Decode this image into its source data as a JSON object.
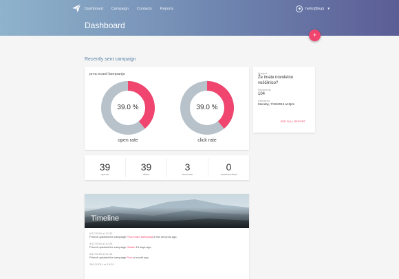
{
  "header": {
    "nav": [
      "Dashboard",
      "Campaign",
      "Contacts",
      "Reports"
    ],
    "user_name": "hello@kupi",
    "page_title": "Dashboard",
    "fab_label": "+"
  },
  "campaign": {
    "section_title": "Recently sent campaign",
    "name": "prva ecard kampanja",
    "open_rate": {
      "value": "39.0 %",
      "label": "open rate",
      "fraction": 0.39
    },
    "click_rate": {
      "value": "39.0 %",
      "label": "click rate",
      "fraction": 0.39
    },
    "colors": {
      "accent": "#f0456e",
      "track": "#b7c2ca"
    }
  },
  "info": {
    "subject_label": "Subject",
    "subject": "Že imate novoletno voščilnico?",
    "recipients_label": "Recipients",
    "recipients": "104",
    "date_label": "Delivered",
    "date": "Monday, 7/15/2015 at 8pm",
    "link_label": "SEE FULL REPORT"
  },
  "stats": [
    {
      "value": "39",
      "label": "opens"
    },
    {
      "value": "39",
      "label": "clicks"
    },
    {
      "value": "3",
      "label": "bounces"
    },
    {
      "value": "0",
      "label": "unsubscribed"
    }
  ],
  "timeline": {
    "title": "Timeline",
    "items": [
      {
        "time": "6/17/2015 at 12:33",
        "prefix": "Primož updated the campaign ",
        "link": "Prva ecard kampanja",
        "suffix": " a few seconds ago."
      },
      {
        "time": "6/17/2015 at 12:28",
        "prefix": "Primož updated the campaign ",
        "link": "Glasilo",
        "suffix": " 15 days ago."
      },
      {
        "time": "6/17/2015 at 21:36",
        "prefix": "Primož updated the campaign ",
        "link": "Prva",
        "suffix": " a month ago."
      },
      {
        "time": "28/12/2014 at 15:29",
        "prefix": "",
        "link": "",
        "suffix": ""
      }
    ]
  }
}
